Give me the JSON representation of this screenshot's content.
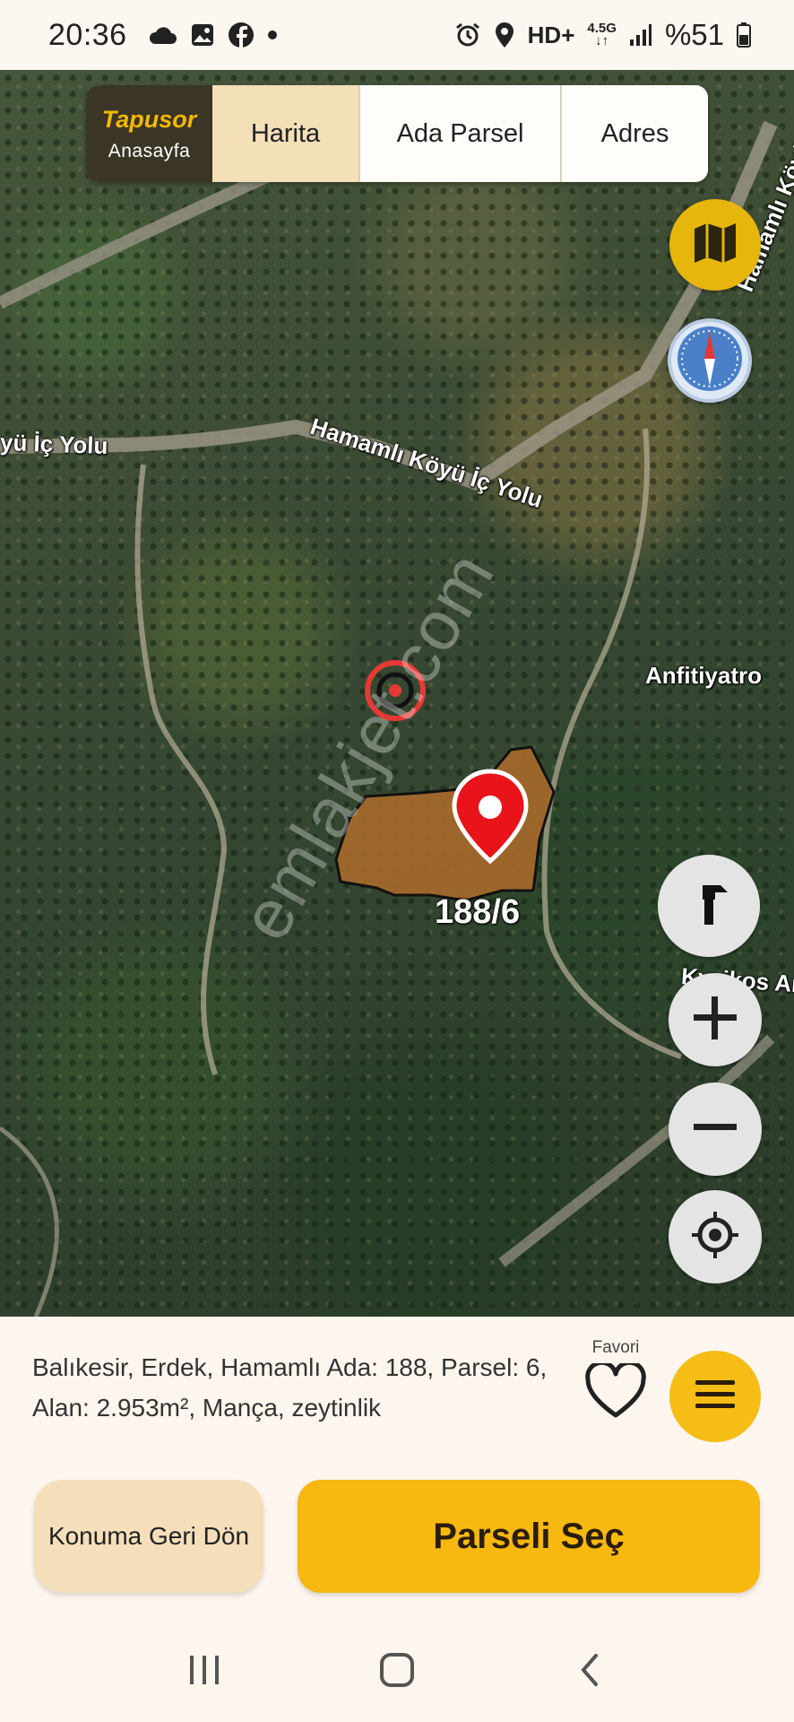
{
  "status_bar": {
    "time": "20:36",
    "network_label": "HD+",
    "network_type_top": "4.5G",
    "network_type_bottom": "↓↑",
    "battery": "%51",
    "icons": [
      "cloud-icon",
      "gallery-icon",
      "facebook-icon",
      "dot-icon",
      "alarm-icon",
      "location-icon",
      "signal-icon",
      "battery-icon"
    ]
  },
  "nav": {
    "brand_logo": "Tapusor",
    "brand_sub": "Anasayfa",
    "tabs": [
      {
        "label": "Harita",
        "active": true
      },
      {
        "label": "Ada Parsel",
        "active": false
      },
      {
        "label": "Adres",
        "active": false
      }
    ]
  },
  "map": {
    "road_labels": {
      "left": "yü İç Yolu",
      "main": "Hamamlı Köyü İç Yolu",
      "side": "Hamamlı Köyü",
      "place1": "Anfitiyatro",
      "place2": "Kyzikos An"
    },
    "watermark": "emlakjet.com",
    "parcel_label": "188/6",
    "controls": [
      "map-layers-icon",
      "compass-icon",
      "measure-icon",
      "zoom-in-icon",
      "zoom-out-icon",
      "locate-icon"
    ]
  },
  "info": {
    "text": "Balıkesir, Erdek, Hamamlı Ada: 188, Parsel: 6, Alan: 2.953m², Mança, zeytinlik",
    "favorite_label": "Favori"
  },
  "actions": {
    "back_label": "Konuma Geri Dön",
    "select_label": "Parseli Seç"
  },
  "colors": {
    "accent": "#f7b80f",
    "brand_dark": "#3b3526",
    "parcel_fill": "#a9692b",
    "target_red": "#e53935",
    "tab_active": "#f3dfb8"
  }
}
